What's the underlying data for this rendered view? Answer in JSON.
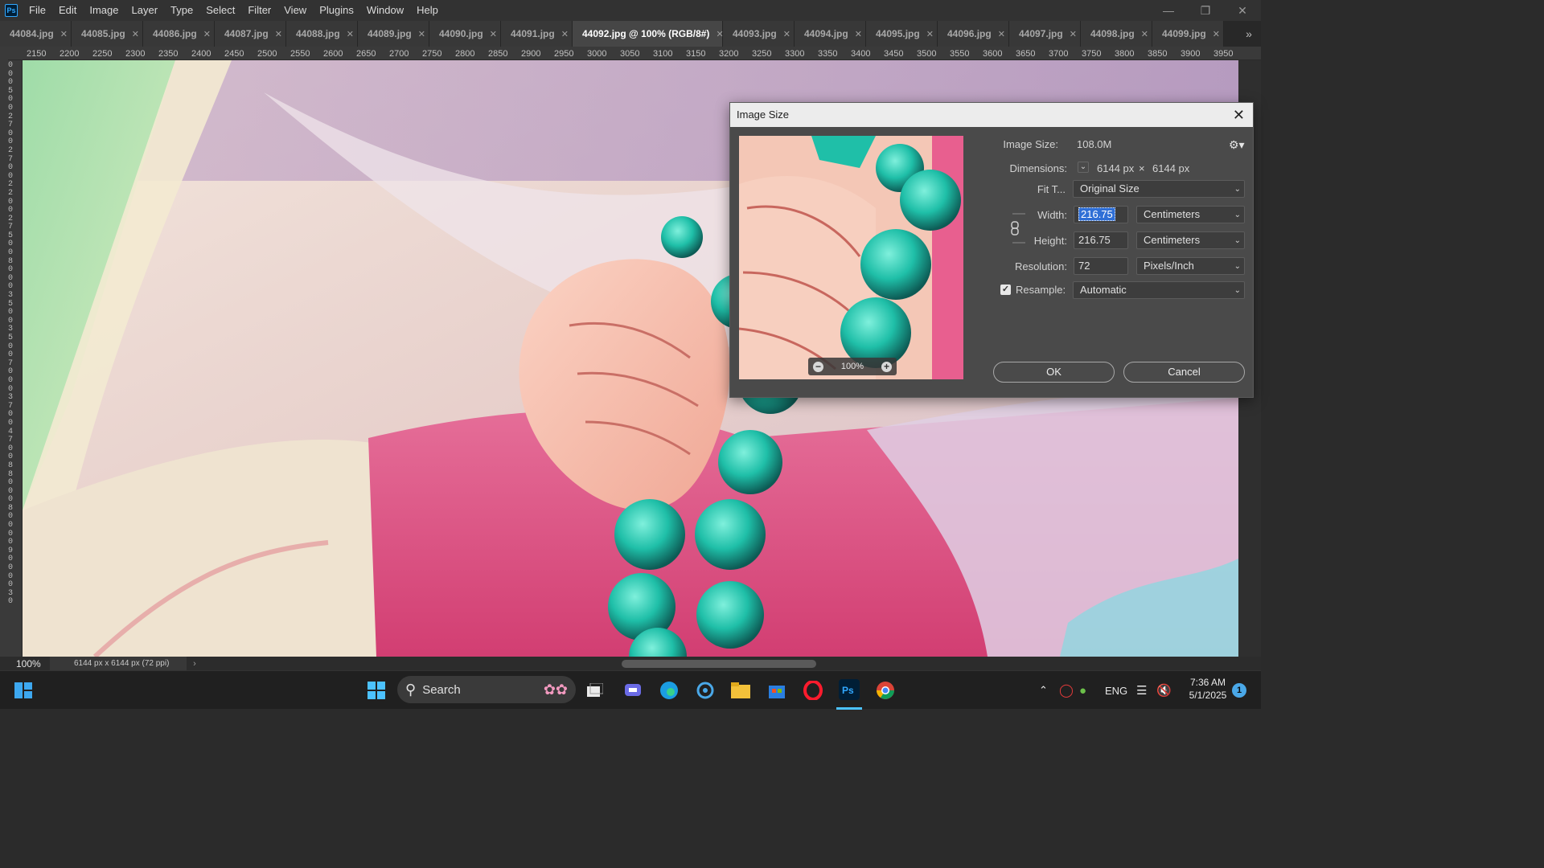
{
  "menubar": {
    "logo": "Ps",
    "items": [
      "File",
      "Edit",
      "Image",
      "Layer",
      "Type",
      "Select",
      "Filter",
      "View",
      "Plugins",
      "Window",
      "Help"
    ]
  },
  "tabs": [
    {
      "label": "44084.jpg"
    },
    {
      "label": "44085.jpg"
    },
    {
      "label": "44086.jpg"
    },
    {
      "label": "44087.jpg"
    },
    {
      "label": "44088.jpg"
    },
    {
      "label": "44089.jpg"
    },
    {
      "label": "44090.jpg"
    },
    {
      "label": "44091.jpg"
    },
    {
      "label": "44092.jpg @ 100% (RGB/8#)",
      "active": true
    },
    {
      "label": "44093.jpg"
    },
    {
      "label": "44094.jpg"
    },
    {
      "label": "44095.jpg"
    },
    {
      "label": "44096.jpg"
    },
    {
      "label": "44097.jpg"
    },
    {
      "label": "44098.jpg"
    },
    {
      "label": "44099.jpg"
    }
  ],
  "ruler_top": [
    "2150",
    "2200",
    "2250",
    "2300",
    "2350",
    "2400",
    "2450",
    "2500",
    "2550",
    "2600",
    "2650",
    "2700",
    "2750",
    "2800",
    "2850",
    "2900",
    "2950",
    "3000",
    "3050",
    "3100",
    "3150",
    "3200",
    "3250",
    "3300",
    "3350",
    "3400",
    "3450",
    "3500",
    "3550",
    "3600",
    "3650",
    "3700",
    "3750",
    "3800",
    "3850",
    "3900",
    "3950"
  ],
  "ruler_left": "0005002700270022002750080003500350070003700470088000800009000030",
  "status": {
    "zoom": "100%",
    "doc_info": "6144 px x 6144 px (72 ppi)"
  },
  "dialog": {
    "title": "Image Size",
    "image_size_label": "Image Size:",
    "image_size_value": "108.0M",
    "dimensions_label": "Dimensions:",
    "dim_width": "6144 px",
    "dim_sep": "×",
    "dim_height": "6144 px",
    "fit_label": "Fit T...",
    "fit_value": "Original Size",
    "width_label": "Width:",
    "width_value": "216.75",
    "width_unit": "Centimeters",
    "height_label": "Height:",
    "height_value": "216.75",
    "height_unit": "Centimeters",
    "resolution_label": "Resolution:",
    "resolution_value": "72",
    "resolution_unit": "Pixels/Inch",
    "resample_label": "Resample:",
    "resample_checked": true,
    "resample_value": "Automatic",
    "preview_zoom": "100%",
    "ok_label": "OK",
    "cancel_label": "Cancel"
  },
  "taskbar": {
    "search_label": "Search",
    "language": "ENG",
    "time": "7:36 AM",
    "date": "5/1/2025",
    "notifications": "1"
  },
  "colors": {
    "accent": "#31a8ff",
    "selection": "#2f6fd6",
    "bead": "#1fbfa8",
    "pink": "#e0457a"
  }
}
